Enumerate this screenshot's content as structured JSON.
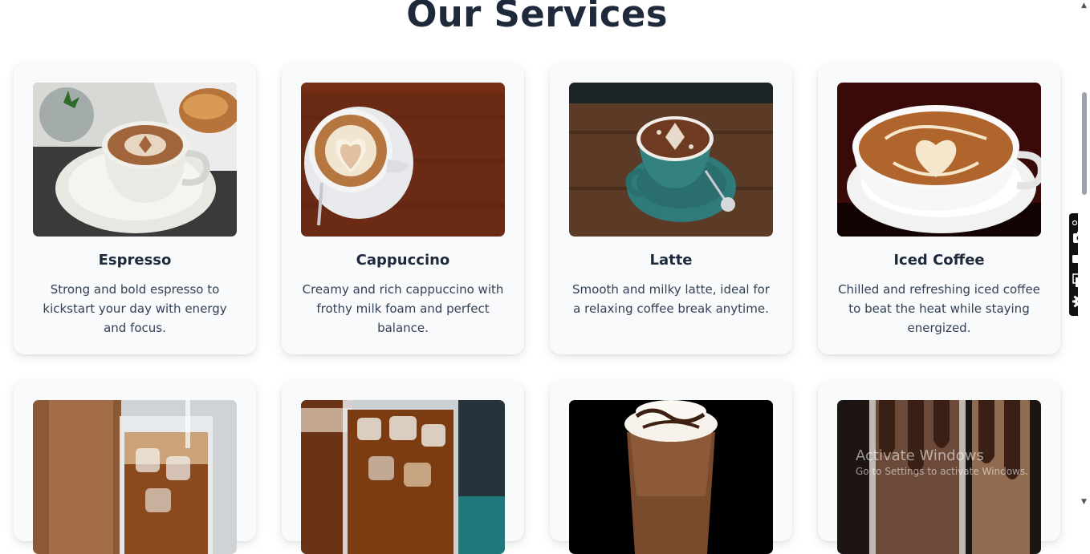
{
  "page": {
    "title": "Our Services"
  },
  "services": [
    {
      "name": "Espresso",
      "description": "Strong and bold espresso to kickstart your day with energy and focus.",
      "image_icon": "espresso-photo"
    },
    {
      "name": "Cappuccino",
      "description": "Creamy and rich cappuccino with frothy milk foam and perfect balance.",
      "image_icon": "cappuccino-photo"
    },
    {
      "name": "Latte",
      "description": "Smooth and milky latte, ideal for a relaxing coffee break anytime.",
      "image_icon": "latte-photo"
    },
    {
      "name": "Iced Coffee",
      "description": "Chilled and refreshing iced coffee to beat the heat while staying energized.",
      "image_icon": "iced-coffee-photo"
    },
    {
      "image_icon": "iced-latte-photo"
    },
    {
      "image_icon": "cold-brew-photo"
    },
    {
      "image_icon": "frappe-photo"
    },
    {
      "image_icon": "mocha-shake-photo"
    }
  ],
  "watermark": {
    "line1": "Activate Windows",
    "line2": "Go to Settings to activate Windows."
  },
  "colors": {
    "title": "#1e293b",
    "card_bg": "#f8fafc",
    "text": "#334155",
    "toolbar": "#111111"
  }
}
